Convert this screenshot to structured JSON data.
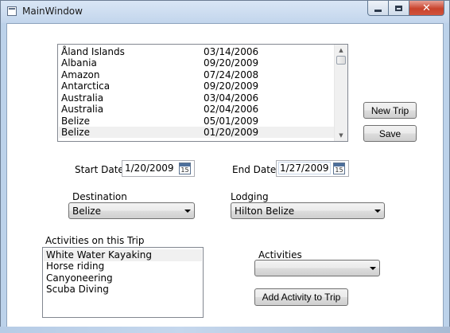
{
  "window": {
    "title": "MainWindow",
    "controls": [
      "minimize",
      "maximize",
      "close"
    ]
  },
  "trips": {
    "rows": [
      {
        "name": "Åland Islands",
        "date": "03/14/2006"
      },
      {
        "name": "Albania",
        "date": "09/20/2009"
      },
      {
        "name": "Amazon",
        "date": "07/24/2008"
      },
      {
        "name": "Antarctica",
        "date": "09/20/2009"
      },
      {
        "name": "Australia",
        "date": "03/04/2006"
      },
      {
        "name": "Australia",
        "date": "02/04/2006"
      },
      {
        "name": "Belize",
        "date": "05/01/2009"
      },
      {
        "name": "Belize",
        "date": "01/20/2009"
      }
    ],
    "selected_index": 7
  },
  "buttons": {
    "new_trip": "New Trip",
    "save": "Save",
    "add_activity": "Add Activity to Trip"
  },
  "dates": {
    "start_label": "Start Date:",
    "start_value": "1/20/2009",
    "end_label": "End Date:",
    "end_value": "1/27/2009",
    "calendar_icon_text": "15"
  },
  "destination": {
    "label": "Destination",
    "selected": "Belize"
  },
  "lodging": {
    "label": "Lodging",
    "selected": "Hilton Belize"
  },
  "trip_activities": {
    "label": "Activities on this Trip",
    "items": [
      "White Water Kayaking",
      "Horse riding",
      "Canyoneering",
      "Scuba Diving"
    ],
    "selected_index": 0
  },
  "activities": {
    "label": "Activities",
    "selected": ""
  },
  "colors": {
    "window_frame": "#bcd2ea",
    "selection": "#f0f0f0",
    "close_button": "#c8432c"
  }
}
